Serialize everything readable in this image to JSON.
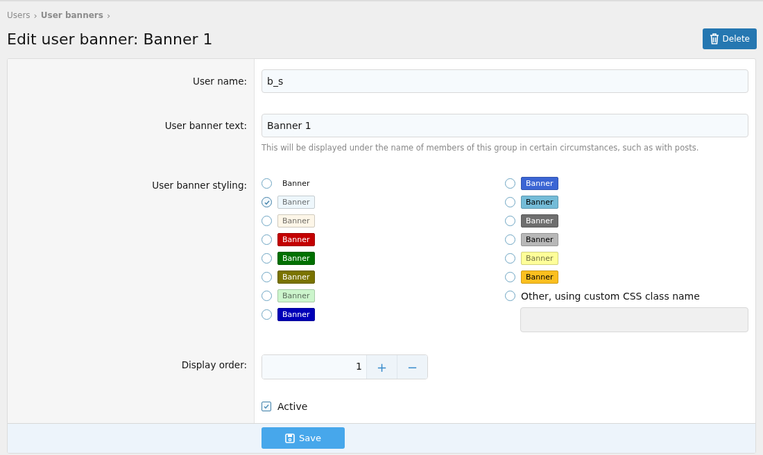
{
  "breadcrumb": [
    {
      "label": "Users",
      "bold": false
    },
    {
      "label": "User banners",
      "bold": true
    }
  ],
  "breadcrumb_separator": "›",
  "title": "Edit user banner: Banner 1",
  "delete_button": "Delete",
  "form": {
    "user_name": {
      "label": "User name:",
      "value": "b_s"
    },
    "banner_text": {
      "label": "User banner text:",
      "value": "Banner 1",
      "hint": "This will be displayed under the name of members of this group in certain circumstances, such as with posts."
    },
    "styling": {
      "label": "User banner styling:",
      "columns": [
        [
          {
            "kind": "plain",
            "label": "Banner",
            "selected": false
          },
          {
            "kind": "badge",
            "label": "Banner",
            "color": "#eef7fc",
            "selected": true
          },
          {
            "kind": "badge",
            "label": "Banner",
            "color": "#fdf6e8",
            "selected": false
          },
          {
            "kind": "badge",
            "label": "Banner",
            "color": "#c30000",
            "selected": false
          },
          {
            "kind": "badge",
            "label": "Banner",
            "color": "#007000",
            "selected": false
          },
          {
            "kind": "badge",
            "label": "Banner",
            "color": "#7a7300",
            "selected": false
          },
          {
            "kind": "badge",
            "label": "Banner",
            "color": "#ccf5cc",
            "selected": false
          },
          {
            "kind": "badge",
            "label": "Banner",
            "color": "#0000b8",
            "selected": false
          }
        ],
        [
          {
            "kind": "badge",
            "label": "Banner",
            "color": "#3b65d4",
            "selected": false
          },
          {
            "kind": "badge",
            "label": "Banner",
            "color": "#74bcd8",
            "selected": false
          },
          {
            "kind": "badge",
            "label": "Banner",
            "color": "#6e6e6e",
            "selected": false
          },
          {
            "kind": "badge",
            "label": "Banner",
            "color": "#b8b8b8",
            "selected": false
          },
          {
            "kind": "badge",
            "label": "Banner",
            "color": "#ffff99",
            "selected": false
          },
          {
            "kind": "badge",
            "label": "Banner",
            "color": "#fbbf1f",
            "selected": false
          },
          {
            "kind": "custom",
            "label": "Other, using custom CSS class name",
            "selected": false
          }
        ]
      ]
    },
    "display_order": {
      "label": "Display order:",
      "value": "1",
      "plus": "+",
      "minus": "−"
    },
    "active": {
      "label": "Active",
      "checked": true
    },
    "save_button": "Save"
  }
}
